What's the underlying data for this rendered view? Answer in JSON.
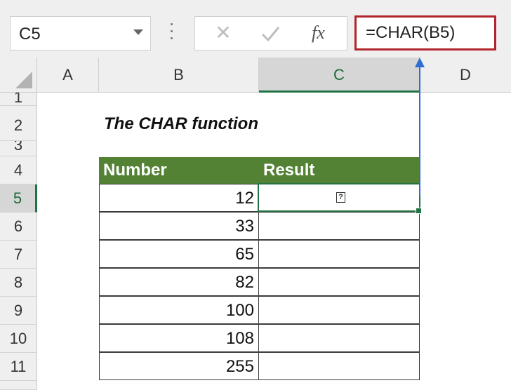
{
  "name_box": {
    "value": "C5"
  },
  "formula_bar": {
    "cancel_symbol": "✕",
    "fx_label": "fx",
    "formula": "=CHAR(B5)"
  },
  "columns": [
    "A",
    "B",
    "C",
    "D"
  ],
  "rows": [
    "1",
    "2",
    "3",
    "4",
    "5",
    "6",
    "7",
    "8",
    "9",
    "10",
    "11"
  ],
  "selected_column": "C",
  "selected_row": "5",
  "sheet": {
    "title": "The CHAR function",
    "table": {
      "headers": [
        "Number",
        "Result"
      ],
      "rows": [
        {
          "number": "12",
          "result": ""
        },
        {
          "number": "33",
          "result": ""
        },
        {
          "number": "65",
          "result": ""
        },
        {
          "number": "82",
          "result": ""
        },
        {
          "number": "100",
          "result": ""
        },
        {
          "number": "108",
          "result": ""
        },
        {
          "number": "255",
          "result": ""
        }
      ],
      "active_result_glyph": "?"
    }
  },
  "colors": {
    "header_fill": "#548235",
    "selection": "#217346",
    "formula_highlight": "#b2242b",
    "arrow": "#2f6fd1"
  }
}
